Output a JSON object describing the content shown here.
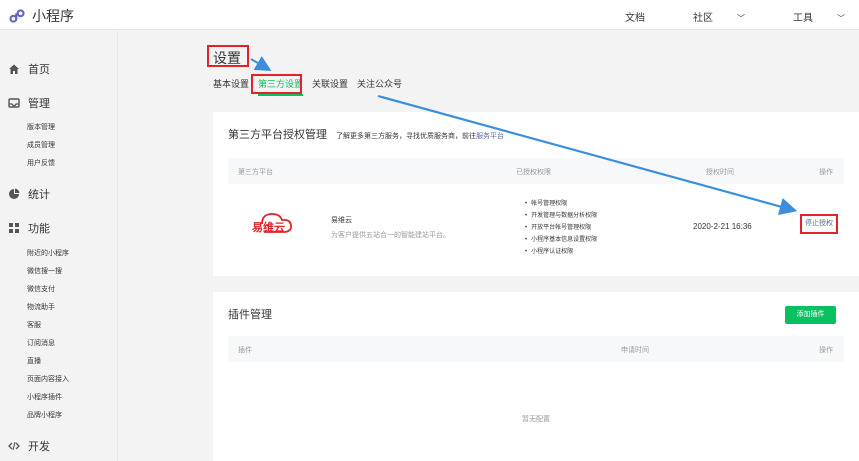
{
  "app": {
    "title": "小程序"
  },
  "topbar": {
    "docs": "文档",
    "community": "社区",
    "tools": "工具"
  },
  "sidebar": {
    "groups": [
      {
        "label": "首页"
      },
      {
        "label": "管理",
        "items": [
          "版本管理",
          "成员管理",
          "用户反馈"
        ]
      },
      {
        "label": "统计"
      },
      {
        "label": "功能",
        "items": [
          "附近的小程序",
          "微信搜一搜",
          "微信支付",
          "物流助手",
          "客服",
          "订阅消息",
          "直播",
          "页面内容接入",
          "小程序插件",
          "品牌小程序"
        ]
      },
      {
        "label": "开发"
      }
    ]
  },
  "main": {
    "page_title": "设置",
    "tabs": [
      "基本设置",
      "第三方设置",
      "关联设置",
      "关注公众号"
    ],
    "auth_card": {
      "title": "第三方平台授权管理",
      "subtitle": "了解更多第三方服务，寻找优质服务商，前往",
      "subtitle_link": "服务平台",
      "columns": [
        "第三方平台",
        "已授权权限",
        "授权时间",
        "操作"
      ],
      "row": {
        "brand_text": "易维云",
        "name": "易维云",
        "desc": "为客户提供五站合一的智能建站平台。",
        "permissions": [
          "帐号管理权限",
          "开发管理与数据分析权限",
          "开放平台帐号管理权限",
          "小程序基本信息设置权限",
          "小程序认证权限"
        ],
        "time": "2020-2-21 16:36",
        "action": "停止授权"
      }
    },
    "plugin_card": {
      "title": "插件管理",
      "add_button": "添加插件",
      "columns": [
        "插件",
        "申请时间",
        "操作"
      ],
      "empty": "暂无配置"
    }
  },
  "colors": {
    "accent": "#07c160",
    "annotation": "#e2242a",
    "arrow": "#3b8ede",
    "link": "#576b95"
  }
}
